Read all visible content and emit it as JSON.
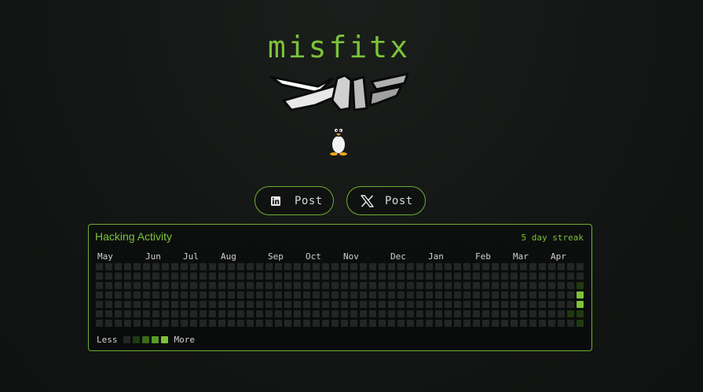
{
  "header": {
    "title": "misfitx",
    "logo_icon": "winged-logo-icon",
    "mascot_icon": "penguin-icon"
  },
  "social_links": [
    {
      "platform": "linkedin",
      "icon": "linkedin-icon",
      "label": "Post"
    },
    {
      "platform": "x",
      "icon": "x-icon",
      "label": "Post"
    }
  ],
  "activity": {
    "title": "Hacking Activity",
    "streak_text": "5 day streak",
    "months": [
      "May",
      "Jun",
      "Jul",
      "Aug",
      "Sep",
      "Oct",
      "Nov",
      "Dec",
      "Jan",
      "Feb",
      "Mar",
      "Apr"
    ],
    "week_count": 52,
    "days_per_week": 7,
    "active_days": [
      {
        "week": 51,
        "day": 2,
        "level": 1
      },
      {
        "week": 51,
        "day": 3,
        "level": 4
      },
      {
        "week": 51,
        "day": 4,
        "level": 4
      },
      {
        "week": 51,
        "day": 5,
        "level": 1
      },
      {
        "week": 51,
        "day": 6,
        "level": 1
      },
      {
        "week": 50,
        "day": 5,
        "level": 1
      }
    ],
    "legend": {
      "less_label": "Less",
      "more_label": "More",
      "levels": 5
    }
  },
  "colors": {
    "accent": "#7cc23a",
    "border": "#6fae33",
    "cell_levels": [
      "#242625",
      "#1f3a12",
      "#3a6a1c",
      "#5a9a2a",
      "#7cc23a"
    ]
  }
}
